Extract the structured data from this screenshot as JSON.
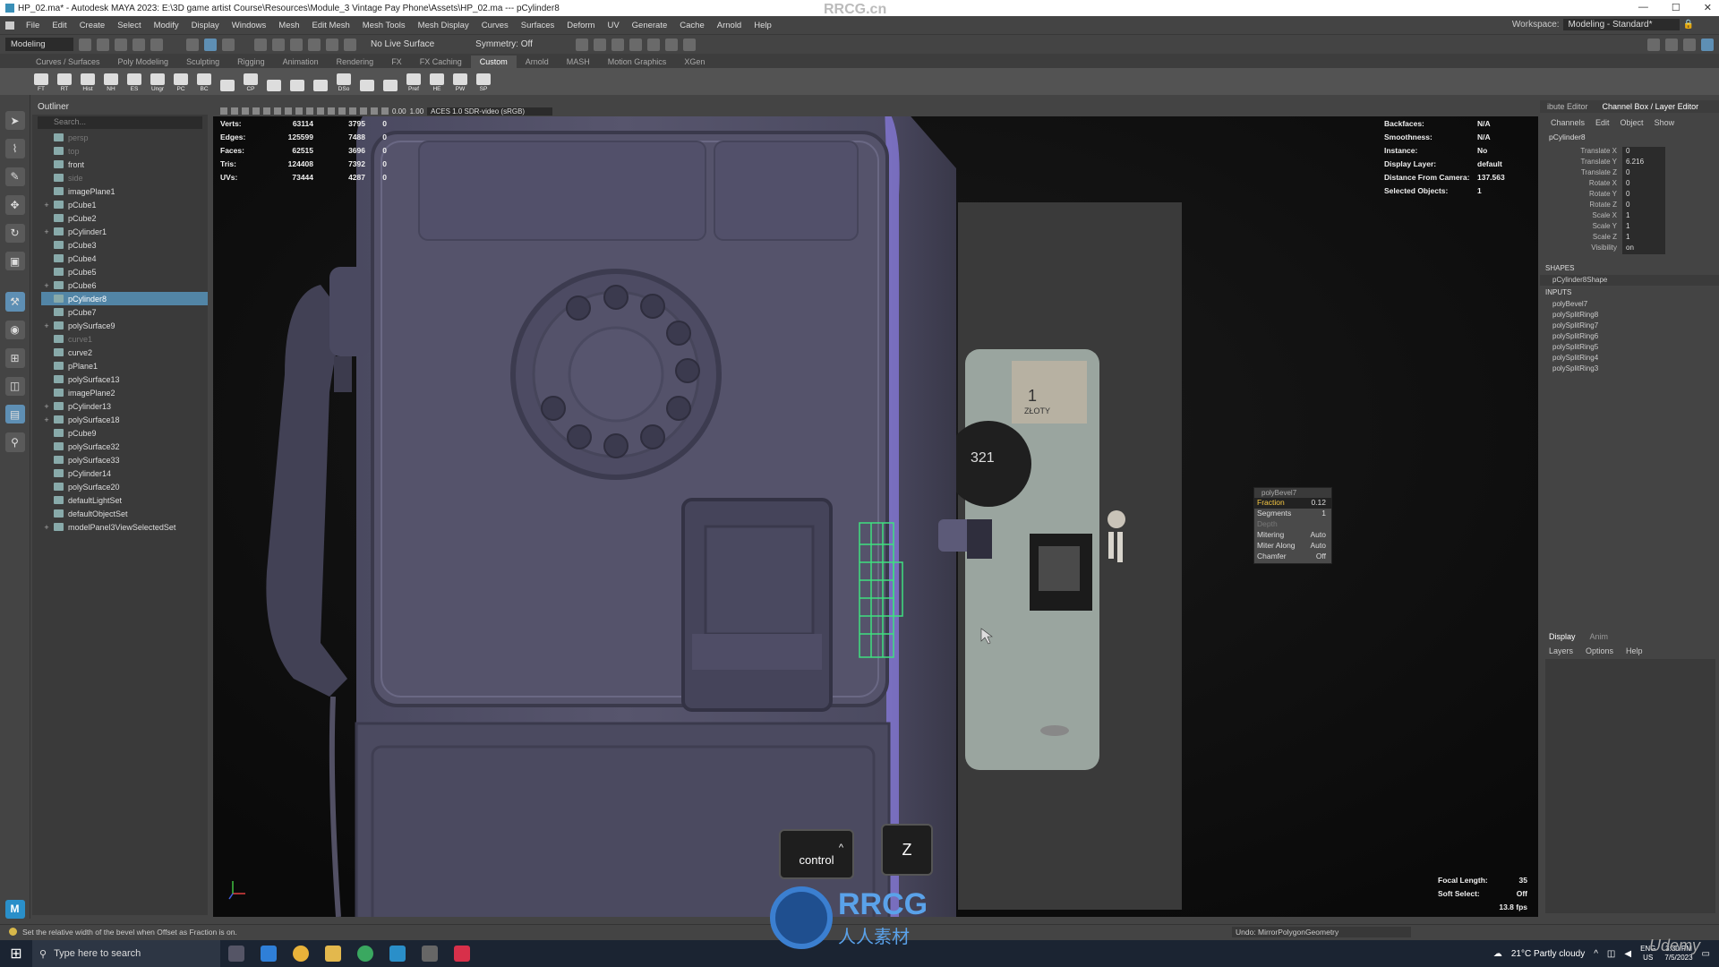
{
  "titlebar": {
    "title": "HP_02.ma* - Autodesk MAYA 2023: E:\\3D game artist Course\\Resources\\Module_3 Vintage Pay Phone\\Assets\\HP_02.ma  ---  pCylinder8",
    "watermark": "RRCG.cn",
    "minimize": "—",
    "maximize": "☐",
    "close": "✕"
  },
  "menubar": {
    "items": [
      "File",
      "Edit",
      "Create",
      "Select",
      "Modify",
      "Display",
      "Windows",
      "Mesh",
      "Edit Mesh",
      "Mesh Tools",
      "Mesh Display",
      "Curves",
      "Surfaces",
      "Deform",
      "UV",
      "Generate",
      "Cache",
      "Arnold",
      "Help"
    ],
    "workspace_label": "Workspace:",
    "workspace_value": "Modeling - Standard*"
  },
  "statusline": {
    "mode": "Modeling",
    "live_surface": "No Live Surface",
    "symmetry": "Symmetry: Off"
  },
  "shelf": {
    "tabs": [
      "Curves / Surfaces",
      "Poly Modeling",
      "Sculpting",
      "Rigging",
      "Animation",
      "Rendering",
      "FX",
      "FX Caching",
      "Custom",
      "Arnold",
      "MASH",
      "Motion Graphics",
      "XGen"
    ],
    "active_tab": "Custom",
    "buttons": [
      "FT",
      "RT",
      "Hist",
      "NH",
      "ES",
      "Ungr",
      "PC",
      "BC",
      "",
      "CP",
      "",
      "",
      "",
      "DSo",
      "",
      "",
      "Pref",
      "HE",
      "PW",
      "SP"
    ]
  },
  "outliner": {
    "title": "Outliner",
    "search_placeholder": "Search...",
    "items": [
      {
        "label": "persp",
        "dim": true,
        "exp": ""
      },
      {
        "label": "top",
        "dim": true,
        "exp": ""
      },
      {
        "label": "front",
        "dim": false,
        "exp": ""
      },
      {
        "label": "side",
        "dim": true,
        "exp": ""
      },
      {
        "label": "imagePlane1",
        "dim": false,
        "exp": ""
      },
      {
        "label": "pCube1",
        "dim": false,
        "exp": "+"
      },
      {
        "label": "pCube2",
        "dim": false,
        "exp": ""
      },
      {
        "label": "pCylinder1",
        "dim": false,
        "exp": "+"
      },
      {
        "label": "pCube3",
        "dim": false,
        "exp": ""
      },
      {
        "label": "pCube4",
        "dim": false,
        "exp": ""
      },
      {
        "label": "pCube5",
        "dim": false,
        "exp": ""
      },
      {
        "label": "pCube6",
        "dim": false,
        "exp": "+"
      },
      {
        "label": "pCylinder8",
        "dim": false,
        "exp": "",
        "selected": true
      },
      {
        "label": "pCube7",
        "dim": false,
        "exp": ""
      },
      {
        "label": "polySurface9",
        "dim": false,
        "exp": "+"
      },
      {
        "label": "curve1",
        "dim": true,
        "exp": ""
      },
      {
        "label": "curve2",
        "dim": false,
        "exp": ""
      },
      {
        "label": "pPlane1",
        "dim": false,
        "exp": ""
      },
      {
        "label": "polySurface13",
        "dim": false,
        "exp": ""
      },
      {
        "label": "imagePlane2",
        "dim": false,
        "exp": ""
      },
      {
        "label": "pCylinder13",
        "dim": false,
        "exp": "+"
      },
      {
        "label": "polySurface18",
        "dim": false,
        "exp": "+"
      },
      {
        "label": "pCube9",
        "dim": false,
        "exp": ""
      },
      {
        "label": "polySurface32",
        "dim": false,
        "exp": ""
      },
      {
        "label": "polySurface33",
        "dim": false,
        "exp": ""
      },
      {
        "label": "pCylinder14",
        "dim": false,
        "exp": ""
      },
      {
        "label": "polySurface20",
        "dim": false,
        "exp": ""
      },
      {
        "label": "defaultLightSet",
        "dim": false,
        "exp": ""
      },
      {
        "label": "defaultObjectSet",
        "dim": false,
        "exp": ""
      },
      {
        "label": "modelPanel3ViewSelectedSet",
        "dim": false,
        "exp": "+"
      }
    ]
  },
  "viewport": {
    "colorspace": "ACES 1.0 SDR-video (sRGB)",
    "field1": "0.00",
    "field2": "1.00",
    "stats": [
      {
        "label": "Verts:",
        "a": "63114",
        "b": "3795",
        "c": "0"
      },
      {
        "label": "Edges:",
        "a": "125599",
        "b": "7488",
        "c": "0"
      },
      {
        "label": "Faces:",
        "a": "62515",
        "b": "3696",
        "c": "0"
      },
      {
        "label": "Tris:",
        "a": "124408",
        "b": "7392",
        "c": "0"
      },
      {
        "label": "UVs:",
        "a": "73444",
        "b": "4287",
        "c": "0"
      }
    ],
    "info": [
      {
        "label": "Backfaces:",
        "value": "N/A"
      },
      {
        "label": "Smoothness:",
        "value": "N/A"
      },
      {
        "label": "Instance:",
        "value": "No"
      },
      {
        "label": "Display Layer:",
        "value": "default"
      },
      {
        "label": "Distance From Camera:",
        "value": "137.563"
      },
      {
        "label": "Selected Objects:",
        "value": "1"
      }
    ],
    "focal_label": "Focal Length:",
    "focal_value": "35",
    "soft_label": "Soft Select:",
    "soft_value": "Off",
    "fps": "13.8 fps",
    "phone_label_1": "1",
    "phone_label_zloty": "ZŁOTY",
    "phone_dial_digits": "321"
  },
  "bevel_hud": {
    "title": "polyBevel7",
    "rows": [
      {
        "k": "Fraction",
        "v": "0.12",
        "hl": true
      },
      {
        "k": "Segments",
        "v": "1"
      },
      {
        "k": "Depth",
        "v": "",
        "dim": true
      },
      {
        "k": "Mitering",
        "v": "Auto"
      },
      {
        "k": "Miter Along",
        "v": "Auto"
      },
      {
        "k": "Chamfer",
        "v": "Off"
      }
    ]
  },
  "keys": {
    "ctrl_arrow": "^",
    "ctrl_label": "control",
    "z_label": "Z"
  },
  "channelbox": {
    "tabs": [
      "ibute Editor",
      "Channel Box / Layer Editor"
    ],
    "menu": [
      "Channels",
      "Edit",
      "Object",
      "Show"
    ],
    "object": "pCylinder8",
    "attrs": [
      {
        "n": "Translate X",
        "v": "0"
      },
      {
        "n": "Translate Y",
        "v": "6.216"
      },
      {
        "n": "Translate Z",
        "v": "0"
      },
      {
        "n": "Rotate X",
        "v": "0"
      },
      {
        "n": "Rotate Y",
        "v": "0"
      },
      {
        "n": "Rotate Z",
        "v": "0"
      },
      {
        "n": "Scale X",
        "v": "1"
      },
      {
        "n": "Scale Y",
        "v": "1"
      },
      {
        "n": "Scale Z",
        "v": "1"
      },
      {
        "n": "Visibility",
        "v": "on"
      }
    ],
    "shapes_h": "SHAPES",
    "shape": "pCylinder8Shape",
    "inputs_h": "INPUTS",
    "inputs": [
      "polyBevel7",
      "polySplitRing8",
      "polySplitRing7",
      "polySplitRing6",
      "polySplitRing5",
      "polySplitRing4",
      "polySplitRing3"
    ]
  },
  "layers": {
    "tabs": [
      "Display",
      "Anim"
    ],
    "menu": [
      "Layers",
      "Options",
      "Help"
    ]
  },
  "helpline": {
    "text": "Set the relative width of the bevel when Offset as Fraction is on.",
    "undo": "Undo: MirrorPolygonGeometry"
  },
  "taskbar": {
    "search": "Type here to search",
    "weather": "21°C  Partly cloudy",
    "lang": "ENG",
    "region": "US",
    "time": "3:30 PM",
    "date": "7/5/2023"
  },
  "watermarks": {
    "rrcg": "RRCG",
    "sub": "人人素材",
    "udemy": "Udemy"
  },
  "colors": {
    "selection": "#5285a6",
    "model_purple": "#54526a",
    "edge_highlight": "#8f7fe0",
    "hud_yellow": "#f7c843",
    "selected_edges": "#3fe080"
  }
}
